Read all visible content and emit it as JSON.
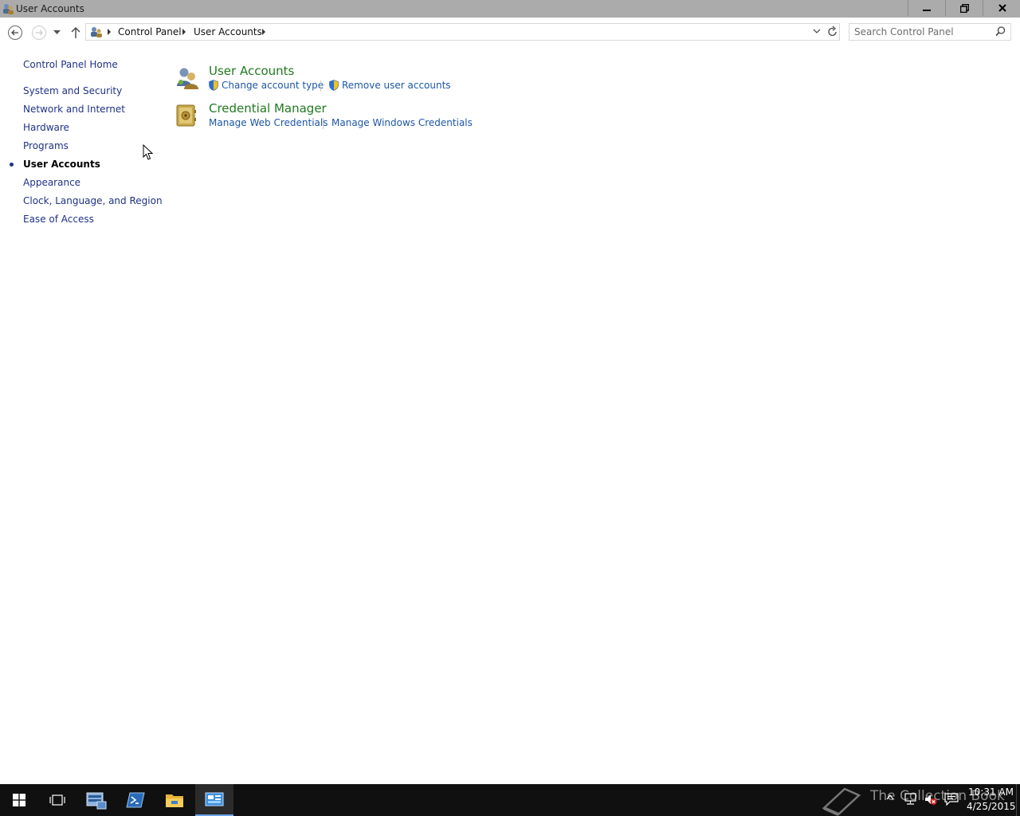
{
  "window": {
    "title": "User Accounts"
  },
  "breadcrumb": {
    "items": [
      "Control Panel",
      "User Accounts"
    ]
  },
  "search": {
    "placeholder": "Search Control Panel"
  },
  "sidebar": {
    "home": "Control Panel Home",
    "items": [
      {
        "label": "System and Security",
        "current": false
      },
      {
        "label": "Network and Internet",
        "current": false
      },
      {
        "label": "Hardware",
        "current": false
      },
      {
        "label": "Programs",
        "current": false
      },
      {
        "label": "User Accounts",
        "current": true
      },
      {
        "label": "Appearance",
        "current": false
      },
      {
        "label": "Clock, Language, and Region",
        "current": false
      },
      {
        "label": "Ease of Access",
        "current": false
      }
    ]
  },
  "main": {
    "categories": [
      {
        "title": "User Accounts",
        "icon": "users-icon",
        "tasks": [
          {
            "label": "Change account type",
            "shield": true
          },
          {
            "label": "Remove user accounts",
            "shield": true
          }
        ]
      },
      {
        "title": "Credential Manager",
        "icon": "vault-icon",
        "tasks": [
          {
            "label": "Manage Web Credentials",
            "shield": false
          },
          {
            "label": "Manage Windows Credentials",
            "shield": false
          }
        ]
      }
    ]
  },
  "taskbar": {
    "watermark": "The Collection Book",
    "time": "10:31 AM",
    "date": "4/25/2015"
  },
  "colors": {
    "link": "#1e3287",
    "category_title": "#1e7a1e",
    "task_link": "#1e56a8",
    "titlebar": "#ababab",
    "taskbar": "#101010"
  }
}
